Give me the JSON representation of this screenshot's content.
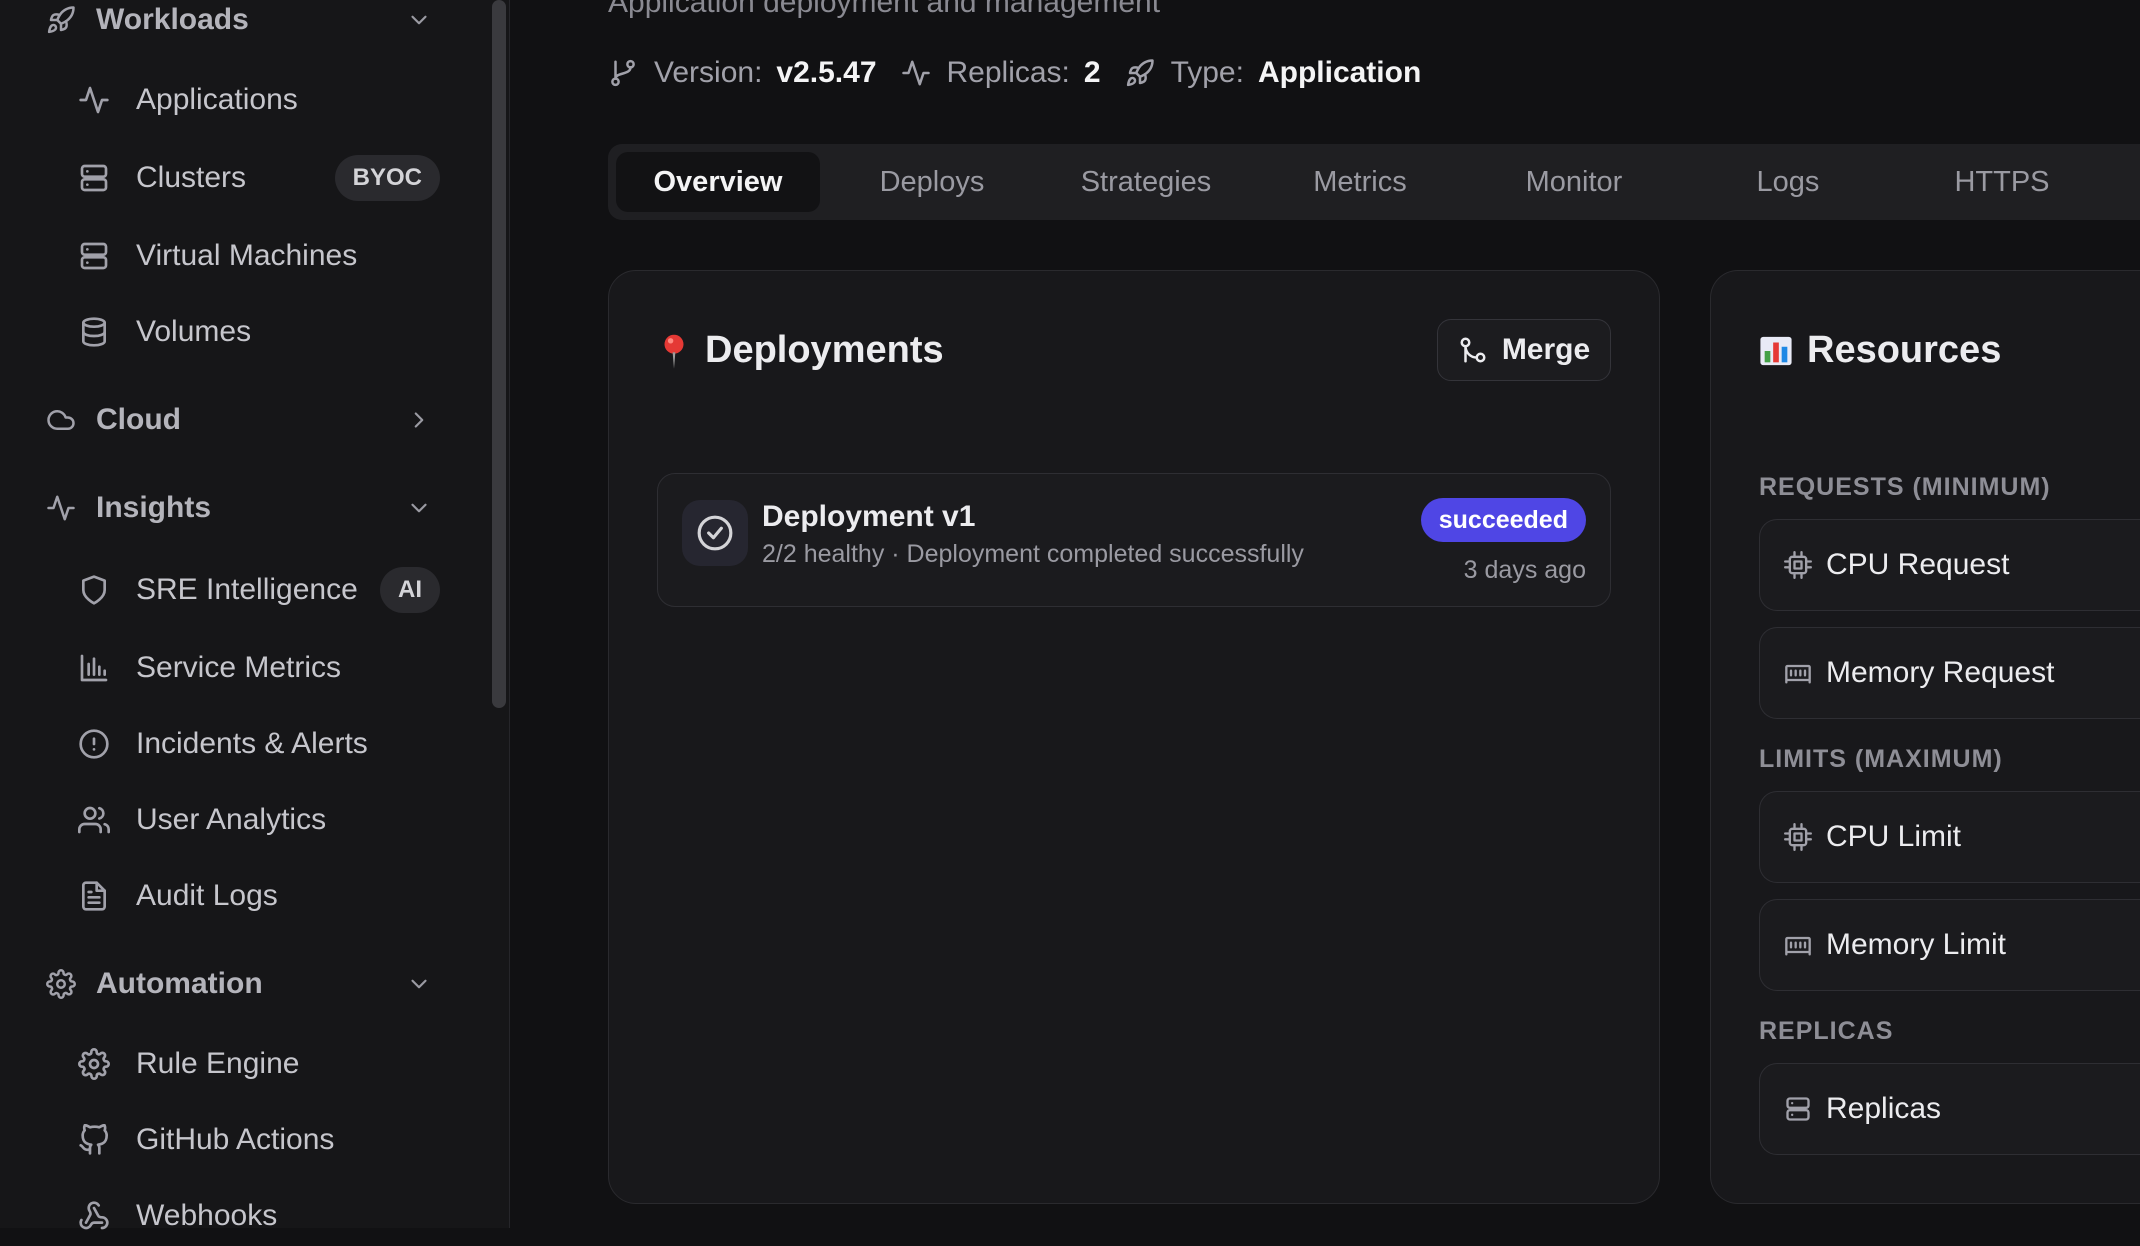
{
  "sidebar": {
    "groups": [
      {
        "label": "Workloads",
        "icon": "rocket-icon",
        "state": "expanded"
      },
      {
        "label": "Cloud",
        "icon": "cloud-icon",
        "state": "collapsed"
      },
      {
        "label": "Insights",
        "icon": "activity-icon",
        "state": "expanded"
      },
      {
        "label": "Automation",
        "icon": "gear-icon",
        "state": "expanded"
      }
    ],
    "items": [
      {
        "label": "Applications",
        "icon": "activity-icon"
      },
      {
        "label": "Clusters",
        "icon": "server-icon",
        "badge": "BYOC"
      },
      {
        "label": "Virtual Machines",
        "icon": "server-icon"
      },
      {
        "label": "Volumes",
        "icon": "database-icon"
      },
      {
        "label": "SRE Intelligence",
        "icon": "shield-icon",
        "badge": "AI"
      },
      {
        "label": "Service Metrics",
        "icon": "bar-chart-icon"
      },
      {
        "label": "Incidents & Alerts",
        "icon": "alert-circle-icon"
      },
      {
        "label": "User Analytics",
        "icon": "users-icon"
      },
      {
        "label": "Audit Logs",
        "icon": "file-text-icon"
      },
      {
        "label": "Rule Engine",
        "icon": "gear-icon"
      },
      {
        "label": "GitHub Actions",
        "icon": "github-icon"
      },
      {
        "label": "Webhooks",
        "icon": "webhook-icon"
      }
    ]
  },
  "header": {
    "subtitle": "Application deployment and management",
    "meta": [
      {
        "key": "Version:",
        "value": "v2.5.47",
        "icon": "git-branch-icon"
      },
      {
        "key": "Replicas:",
        "value": "2",
        "icon": "activity-icon"
      },
      {
        "key": "Type:",
        "value": "Application",
        "icon": "rocket-icon"
      }
    ]
  },
  "tabs": [
    {
      "label": "Overview",
      "active": true
    },
    {
      "label": "Deploys"
    },
    {
      "label": "Strategies"
    },
    {
      "label": "Metrics"
    },
    {
      "label": "Monitor"
    },
    {
      "label": "Logs"
    },
    {
      "label": "HTTPS"
    }
  ],
  "deployments": {
    "title": "Deployments",
    "emoji": "pushpin-icon",
    "merge_label": "Merge",
    "items": [
      {
        "name": "Deployment v1",
        "detail": "2/2 healthy · Deployment completed successfully",
        "status": "succeeded",
        "time": "3 days ago"
      }
    ]
  },
  "resources": {
    "title": "Resources",
    "emoji": "bar-chart-emoji-icon",
    "requests_label": "REQUESTS (MINIMUM)",
    "limits_label": "LIMITS (MAXIMUM)",
    "replicas_label": "REPLICAS",
    "rows": [
      {
        "label": "CPU Request",
        "icon": "cpu-icon"
      },
      {
        "label": "Memory Request",
        "icon": "memory-icon"
      },
      {
        "label": "CPU Limit",
        "icon": "cpu-icon"
      },
      {
        "label": "Memory Limit",
        "icon": "memory-icon"
      },
      {
        "label": "Replicas",
        "icon": "server-icon"
      }
    ]
  },
  "colors": {
    "background": "#111113",
    "sidebar": "#161618",
    "accent": "#4f46e5",
    "card": "#18181b"
  }
}
